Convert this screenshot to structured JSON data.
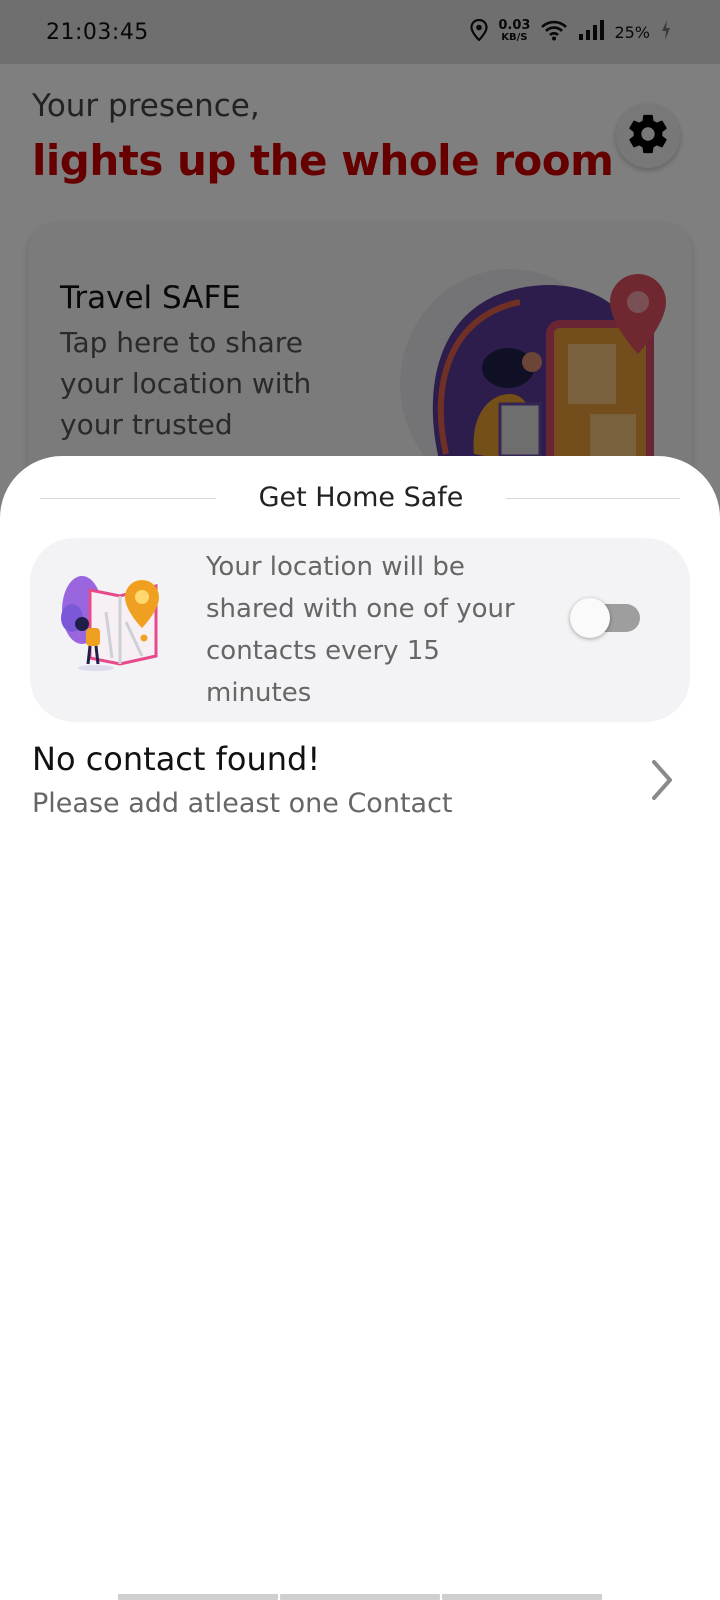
{
  "status_bar": {
    "time": "21:03:45",
    "speed_value": "0.03",
    "speed_unit": "KB/S",
    "battery": "25%",
    "icons": [
      "location-icon",
      "wifi-icon",
      "signal-icon",
      "charging-icon"
    ]
  },
  "header": {
    "greeting": "Your presence,",
    "headline": "lights up the whole room",
    "headline_color": "#cc0000"
  },
  "travel_card": {
    "title": "Travel SAFE",
    "description": "Tap here to share your location with your trusted"
  },
  "sheet": {
    "title": "Get Home Safe",
    "share_card": {
      "description": "Your location will be shared with one of your contacts every 15 minutes",
      "toggle_on": false
    },
    "contact": {
      "title": "No contact found!",
      "subtitle": "Please add atleast one Contact"
    }
  }
}
